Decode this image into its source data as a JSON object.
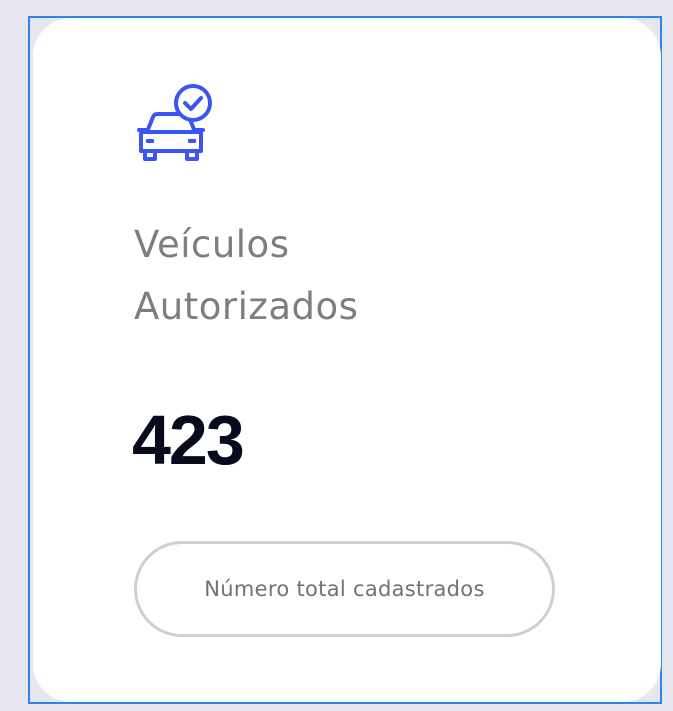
{
  "card": {
    "icon": "car-checkmark-icon",
    "title_line1": "Veículos",
    "title_line2": "Autorizados",
    "count": "423",
    "pill_label": "Número total cadastrados"
  },
  "colors": {
    "accent": "#3b55f5",
    "title": "#7b7f7f",
    "count": "#070b1d",
    "pill_border": "#cdd0d0",
    "background": "#e5e6ef",
    "selection": "#2f86e8"
  }
}
